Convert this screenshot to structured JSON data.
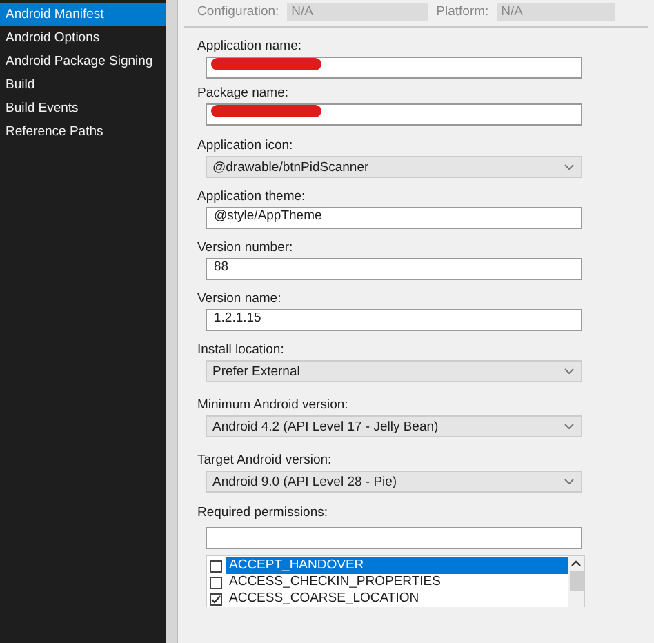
{
  "sidebar": {
    "items": [
      {
        "label": "Android Manifest",
        "selected": true
      },
      {
        "label": "Android Options",
        "selected": false
      },
      {
        "label": "Android Package Signing",
        "selected": false
      },
      {
        "label": "Build",
        "selected": false
      },
      {
        "label": "Build Events",
        "selected": false
      },
      {
        "label": "Reference Paths",
        "selected": false
      }
    ]
  },
  "toolbar": {
    "configuration": {
      "label": "Configuration:",
      "value": "N/A"
    },
    "platform": {
      "label": "Platform:",
      "value": "N/A"
    }
  },
  "fields": [
    {
      "kind": "text",
      "label": "Application name:",
      "redacted": true
    },
    {
      "kind": "text",
      "label": "Package name:",
      "redacted": true
    },
    {
      "kind": "select",
      "label": "Application icon:",
      "value": "@drawable/btnPidScanner"
    },
    {
      "kind": "text",
      "label": "Application theme:",
      "value": "@style/AppTheme"
    },
    {
      "kind": "text",
      "label": "Version number:",
      "value": "88"
    },
    {
      "kind": "text",
      "label": "Version name:",
      "value": "1.2.1.15"
    },
    {
      "kind": "select",
      "label": "Install location:",
      "value": "Prefer External"
    },
    {
      "kind": "select",
      "label": "Minimum Android version:",
      "value": "Android 4.2 (API Level 17 - Jelly Bean)"
    },
    {
      "kind": "select",
      "label": "Target Android version:",
      "value": "Android 9.0 (API Level 28 - Pie)"
    }
  ],
  "permissions": {
    "label": "Required permissions:",
    "items": [
      {
        "label": "ACCEPT_HANDOVER",
        "checked": false,
        "selected": true
      },
      {
        "label": "ACCESS_CHECKIN_PROPERTIES",
        "checked": false,
        "selected": false
      },
      {
        "label": "ACCESS_COARSE_LOCATION",
        "checked": true,
        "selected": false
      }
    ]
  }
}
